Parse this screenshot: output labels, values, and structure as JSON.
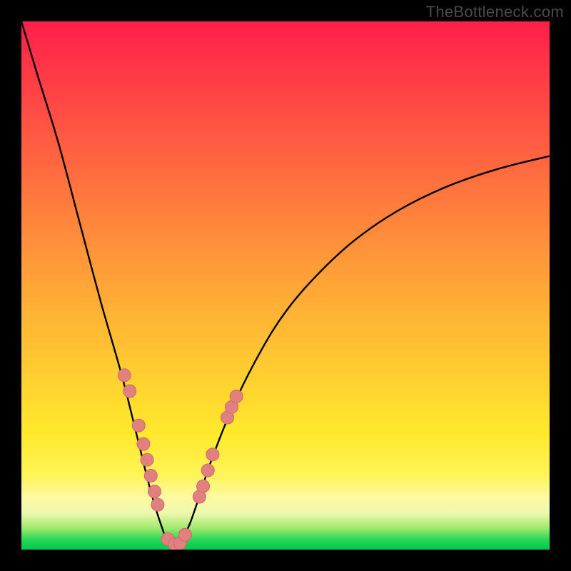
{
  "watermark": "TheBottleneck.com",
  "colors": {
    "curve_stroke": "#000000",
    "marker_fill": "#e28080",
    "marker_stroke": "#d06868",
    "gradient_top": "#ff1f4a",
    "gradient_bottom": "#00c84f"
  },
  "chart_data": {
    "type": "line",
    "title": "",
    "xlabel": "",
    "ylabel": "",
    "xlim": [
      0,
      1
    ],
    "ylim": [
      0,
      1
    ],
    "notes": "Axes are unlabeled; values are relative positions in the plot area (0=left/bottom, 1=right/top). The curve is a deep V with minimum ~0 around x≈0.29; left branch is steep, right branch is shallower and asymptotic toward y≈0.75 at x=1.",
    "series": [
      {
        "name": "bottleneck-curve",
        "x": [
          0.0,
          0.03,
          0.07,
          0.11,
          0.15,
          0.19,
          0.22,
          0.245,
          0.265,
          0.28,
          0.295,
          0.315,
          0.335,
          0.36,
          0.4,
          0.45,
          0.5,
          0.56,
          0.63,
          0.71,
          0.8,
          0.9,
          1.0
        ],
        "y": [
          1.0,
          0.9,
          0.77,
          0.62,
          0.47,
          0.33,
          0.21,
          0.11,
          0.045,
          0.01,
          0.01,
          0.04,
          0.095,
          0.17,
          0.27,
          0.37,
          0.45,
          0.52,
          0.585,
          0.64,
          0.685,
          0.72,
          0.745
        ]
      }
    ],
    "markers": [
      {
        "x": 0.195,
        "y": 0.33
      },
      {
        "x": 0.205,
        "y": 0.3
      },
      {
        "x": 0.222,
        "y": 0.235
      },
      {
        "x": 0.231,
        "y": 0.2
      },
      {
        "x": 0.238,
        "y": 0.17
      },
      {
        "x": 0.245,
        "y": 0.14
      },
      {
        "x": 0.252,
        "y": 0.11
      },
      {
        "x": 0.258,
        "y": 0.085
      },
      {
        "x": 0.277,
        "y": 0.02
      },
      {
        "x": 0.29,
        "y": 0.01
      },
      {
        "x": 0.3,
        "y": 0.012
      },
      {
        "x": 0.31,
        "y": 0.028
      },
      {
        "x": 0.337,
        "y": 0.1
      },
      {
        "x": 0.344,
        "y": 0.12
      },
      {
        "x": 0.353,
        "y": 0.15
      },
      {
        "x": 0.362,
        "y": 0.18
      },
      {
        "x": 0.39,
        "y": 0.25
      },
      {
        "x": 0.398,
        "y": 0.27
      },
      {
        "x": 0.407,
        "y": 0.29
      }
    ]
  }
}
